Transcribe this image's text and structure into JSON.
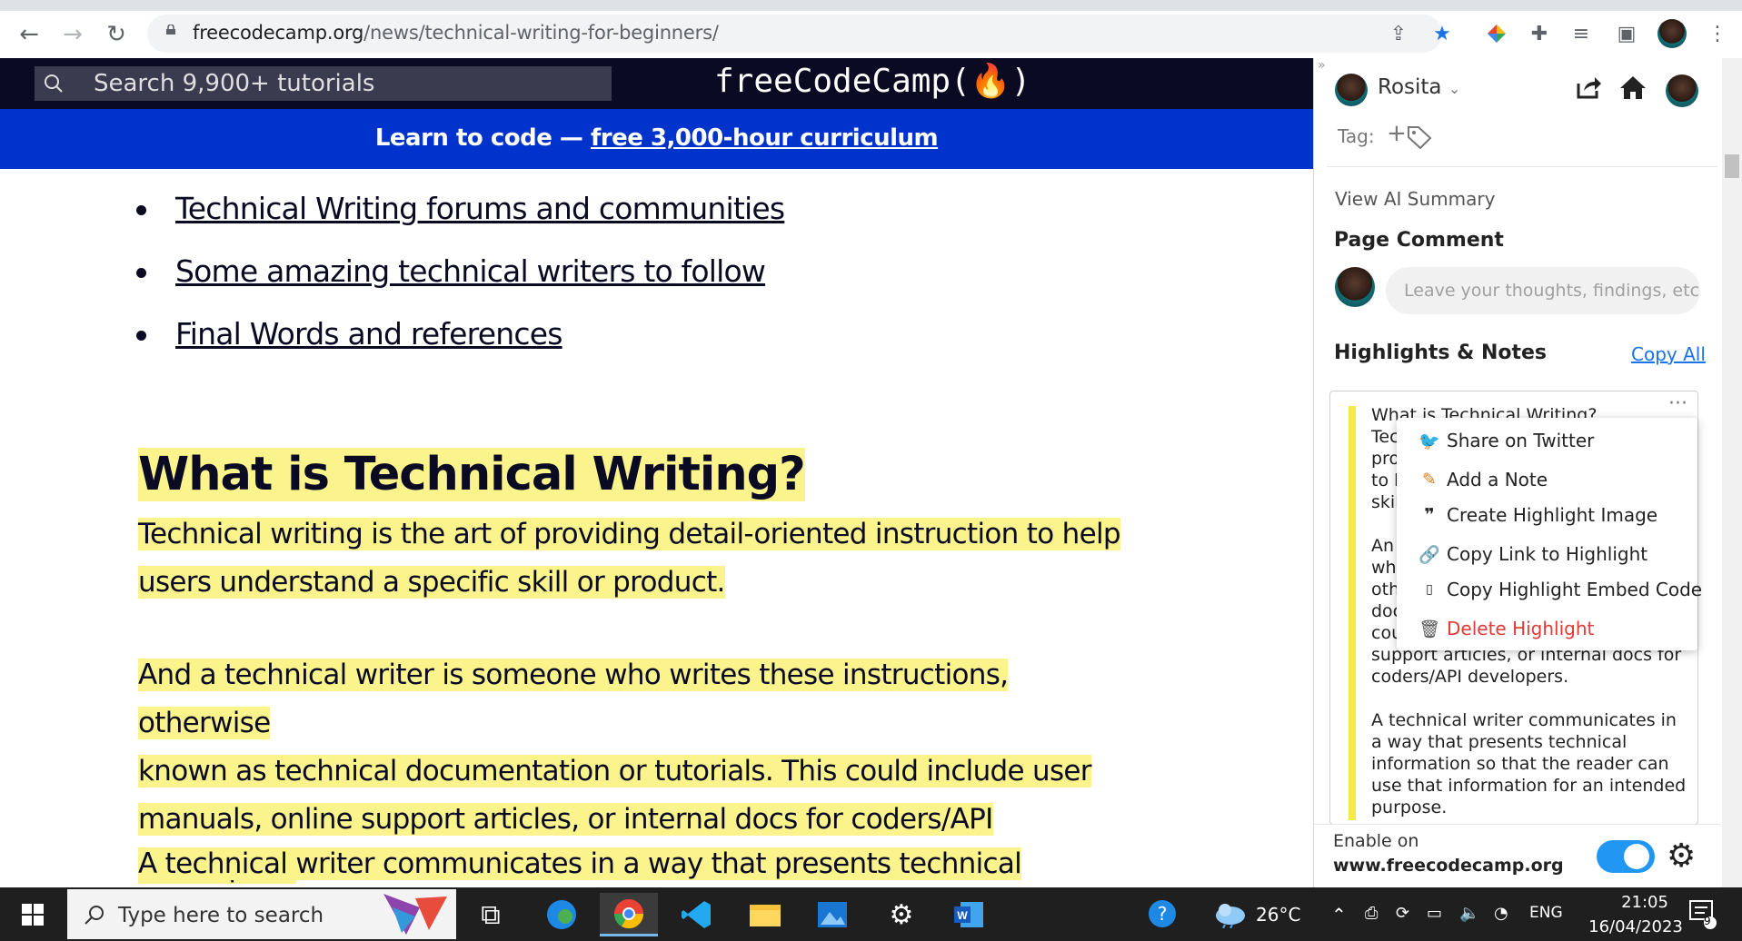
{
  "browser": {
    "url_domain": "freecodecamp.org",
    "url_path": "/news/technical-writing-for-beginners/"
  },
  "fcc": {
    "search_placeholder": "Search 9,900+ tutorials",
    "logo": "freeCodeCamp(🔥)",
    "banner_prefix": "Learn to code — ",
    "banner_link": "free 3,000-hour curriculum"
  },
  "toc": [
    "Technical Writing forums and communities",
    "Some amazing technical writers to follow",
    "Final Words and references"
  ],
  "article": {
    "heading": "What is Technical Writing?",
    "p1_l1": "Technical writing is the art of providing detail-oriented instruction to help",
    "p1_l2": "users understand a specific skill or product.",
    "p2_l1": "And a technical writer is someone who writes these instructions, otherwise",
    "p2_l2": "known as technical documentation or tutorials. This could include user",
    "p2_l3": "manuals, online support articles, or internal docs for coders/API developers.",
    "p3_l1": "A technical writer communicates in a way that presents technical"
  },
  "sidebar": {
    "user_name": "Rosita",
    "tag_label": "Tag:",
    "view_ai_summary": "View AI Summary",
    "page_comment_title": "Page Comment",
    "comment_placeholder": "Leave your thoughts, findings, etc",
    "highlights_title": "Highlights & Notes",
    "copy_all": "Copy All",
    "highlight_text": "What is Technical Writing?\nTec\npro\nto h\nskil\n\nAn\nwh\noth\ndoc\ncou\nsupport articles, or internal docs for\ncoders/API developers.\n\nA technical writer communicates in\na way that presents technical\ninformation so that the reader can\nuse that information for an intended\npurpose.",
    "enable_on": "Enable on",
    "enable_site": "www.freecodecamp.org",
    "toggle_on": true
  },
  "context_menu": {
    "share_twitter": "Share on Twitter",
    "add_note": "Add a Note",
    "create_image": "Create Highlight Image",
    "copy_link": "Copy Link to Highlight",
    "copy_embed": "Copy Highlight Embed Code",
    "delete": "Delete Highlight"
  },
  "taskbar": {
    "search_placeholder": "Type here to search",
    "temperature": "26°C",
    "language": "ENG",
    "time": "21:05",
    "date": "16/04/2023",
    "notif_count": "9"
  },
  "colors": {
    "highlight": "#fbf38c",
    "fcc_dark": "#0a0a23",
    "banner": "#0033cc",
    "toggle": "#2196f3",
    "delete": "#e53935"
  }
}
